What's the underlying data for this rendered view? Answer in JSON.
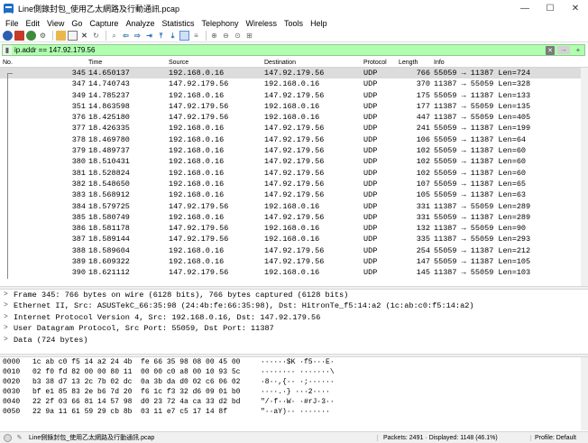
{
  "window": {
    "title": "Line側錄封包_使用乙太網路及行動通訊.pcap",
    "minimize": "—",
    "maximize": "☐",
    "close": "✕"
  },
  "menu": [
    "File",
    "Edit",
    "View",
    "Go",
    "Capture",
    "Analyze",
    "Statistics",
    "Telephony",
    "Wireless",
    "Tools",
    "Help"
  ],
  "filter": {
    "value": "ip.addr == 147.92.179.56",
    "bookmark_icon": "bookmark-icon",
    "clear_symbol": "✕",
    "apply_symbol": "→",
    "add_symbol": "+"
  },
  "columns": {
    "no": "No.",
    "time": "Time",
    "source": "Source",
    "destination": "Destination",
    "protocol": "Protocol",
    "length": "Length",
    "info": "Info"
  },
  "packets": [
    {
      "no": "345",
      "time": "14.650137",
      "src": "192.168.0.16",
      "dst": "147.92.179.56",
      "proto": "UDP",
      "len": "766",
      "info": "55059 → 11387 Len=724"
    },
    {
      "no": "347",
      "time": "14.740743",
      "src": "147.92.179.56",
      "dst": "192.168.0.16",
      "proto": "UDP",
      "len": "370",
      "info": "11387 → 55059 Len=328"
    },
    {
      "no": "349",
      "time": "14.785237",
      "src": "192.168.0.16",
      "dst": "147.92.179.56",
      "proto": "UDP",
      "len": "175",
      "info": "55059 → 11387 Len=133"
    },
    {
      "no": "351",
      "time": "14.863598",
      "src": "147.92.179.56",
      "dst": "192.168.0.16",
      "proto": "UDP",
      "len": "177",
      "info": "11387 → 55059 Len=135"
    },
    {
      "no": "376",
      "time": "18.425180",
      "src": "147.92.179.56",
      "dst": "192.168.0.16",
      "proto": "UDP",
      "len": "447",
      "info": "11387 → 55059 Len=405"
    },
    {
      "no": "377",
      "time": "18.426335",
      "src": "192.168.0.16",
      "dst": "147.92.179.56",
      "proto": "UDP",
      "len": "241",
      "info": "55059 → 11387 Len=199"
    },
    {
      "no": "378",
      "time": "18.469780",
      "src": "192.168.0.16",
      "dst": "147.92.179.56",
      "proto": "UDP",
      "len": "106",
      "info": "55059 → 11387 Len=64"
    },
    {
      "no": "379",
      "time": "18.489737",
      "src": "192.168.0.16",
      "dst": "147.92.179.56",
      "proto": "UDP",
      "len": "102",
      "info": "55059 → 11387 Len=60"
    },
    {
      "no": "380",
      "time": "18.510431",
      "src": "192.168.0.16",
      "dst": "147.92.179.56",
      "proto": "UDP",
      "len": "102",
      "info": "55059 → 11387 Len=60"
    },
    {
      "no": "381",
      "time": "18.528824",
      "src": "192.168.0.16",
      "dst": "147.92.179.56",
      "proto": "UDP",
      "len": "102",
      "info": "55059 → 11387 Len=60"
    },
    {
      "no": "382",
      "time": "18.548650",
      "src": "192.168.0.16",
      "dst": "147.92.179.56",
      "proto": "UDP",
      "len": "107",
      "info": "55059 → 11387 Len=65"
    },
    {
      "no": "383",
      "time": "18.568912",
      "src": "192.168.0.16",
      "dst": "147.92.179.56",
      "proto": "UDP",
      "len": "105",
      "info": "55059 → 11387 Len=63"
    },
    {
      "no": "384",
      "time": "18.579725",
      "src": "147.92.179.56",
      "dst": "192.168.0.16",
      "proto": "UDP",
      "len": "331",
      "info": "11387 → 55059 Len=289"
    },
    {
      "no": "385",
      "time": "18.580749",
      "src": "192.168.0.16",
      "dst": "147.92.179.56",
      "proto": "UDP",
      "len": "331",
      "info": "55059 → 11387 Len=289"
    },
    {
      "no": "386",
      "time": "18.581178",
      "src": "147.92.179.56",
      "dst": "192.168.0.16",
      "proto": "UDP",
      "len": "132",
      "info": "11387 → 55059 Len=90"
    },
    {
      "no": "387",
      "time": "18.589144",
      "src": "147.92.179.56",
      "dst": "192.168.0.16",
      "proto": "UDP",
      "len": "335",
      "info": "11387 → 55059 Len=293"
    },
    {
      "no": "388",
      "time": "18.589604",
      "src": "192.168.0.16",
      "dst": "147.92.179.56",
      "proto": "UDP",
      "len": "254",
      "info": "55059 → 11387 Len=212"
    },
    {
      "no": "389",
      "time": "18.609322",
      "src": "192.168.0.16",
      "dst": "147.92.179.56",
      "proto": "UDP",
      "len": "147",
      "info": "55059 → 11387 Len=105"
    },
    {
      "no": "390",
      "time": "18.621112",
      "src": "147.92.179.56",
      "dst": "192.168.0.16",
      "proto": "UDP",
      "len": "145",
      "info": "11387 → 55059 Len=103"
    }
  ],
  "details": [
    "Frame 345: 766 bytes on wire (6128 bits), 766 bytes captured (6128 bits)",
    "Ethernet II, Src: ASUSTekC_66:35:98 (24:4b:fe:66:35:98), Dst: HitronTe_f5:14:a2 (1c:ab:c0:f5:14:a2)",
    "Internet Protocol Version 4, Src: 192.168.0.16, Dst: 147.92.179.56",
    "User Datagram Protocol, Src Port: 55059, Dst Port: 11387",
    "Data (724 bytes)"
  ],
  "bytes": [
    {
      "offset": "0000",
      "hex": "1c ab c0 f5 14 a2 24 4b  fe 66 35 98 08 00 45 00",
      "ascii": "······$K ·f5···E·"
    },
    {
      "offset": "0010",
      "hex": "02 f0 fd 82 00 00 80 11  00 00 c0 a8 00 10 93 5c",
      "ascii": "········ ·······\\"
    },
    {
      "offset": "0020",
      "hex": "b3 38 d7 13 2c 7b 02 dc  0a 3b da d0 02 c6 06 02",
      "ascii": "·8··,{·· ·;······"
    },
    {
      "offset": "0030",
      "hex": "bf e1 85 83 2e b6 7d 20  f6 1c f3 32 d6 09 01 b0",
      "ascii": "····.·} ···2····"
    },
    {
      "offset": "0040",
      "hex": "22 2f 03 66 81 14 57 98  d0 23 72 4a ca 33 d2 bd",
      "ascii": "\"/·f··W· ·#rJ·3··"
    },
    {
      "offset": "0050",
      "hex": "22 9a 11 61 59 29 cb 8b  03 11 e7 c5 17 14 8f",
      "ascii": "\"··aY)·· ·······"
    }
  ],
  "status": {
    "file": "Line側錄封包_使用乙太網路及行動通訊.pcap",
    "packets": "Packets: 2491 · Displayed: 1148 (46.1%)",
    "profile": "Profile: Default"
  }
}
